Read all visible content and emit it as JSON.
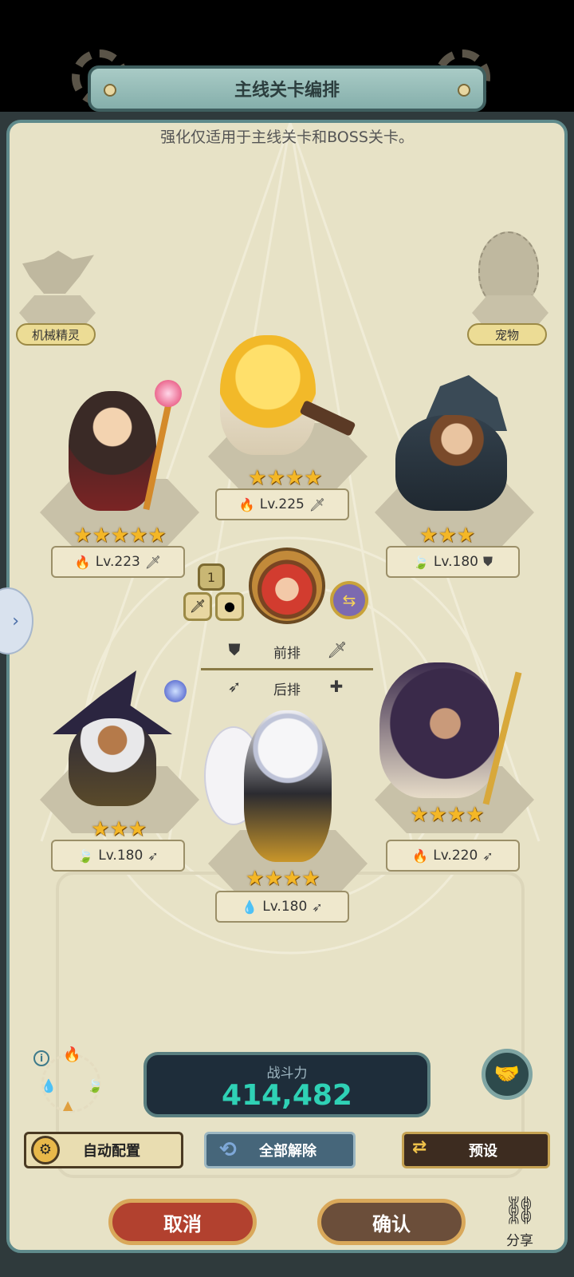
{
  "title": "主线关卡编排",
  "subtitle": "强化仅适用于主线关卡和BOSS关卡。",
  "left_slot": {
    "label": "机械精灵"
  },
  "right_slot": {
    "label": "宠物"
  },
  "heroes": {
    "top_center": {
      "stars": 4,
      "level": "Lv.225",
      "element": "fire",
      "role": "sword"
    },
    "front_left": {
      "stars": 5,
      "level": "Lv.223",
      "element": "fire",
      "role": "sword"
    },
    "front_right": {
      "stars": 3,
      "level": "Lv.180",
      "element": "wind",
      "role": "shield"
    },
    "back_left": {
      "stars": 3,
      "level": "Lv.180",
      "element": "wind",
      "role": "bow"
    },
    "back_center": {
      "stars": 4,
      "level": "Lv.180",
      "element": "water",
      "role": "bow"
    },
    "back_right": {
      "stars": 4,
      "level": "Lv.220",
      "element": "fire",
      "role": "bow"
    }
  },
  "leader": {
    "badge": "1"
  },
  "rows": {
    "front": "前排",
    "back": "后排"
  },
  "power": {
    "label": "战斗力",
    "value": "414,482"
  },
  "buttons": {
    "auto": "自动配置",
    "unequip_all": "全部解除",
    "preset": "预设",
    "cancel": "取消",
    "confirm": "确认",
    "share": "分享"
  },
  "colors": {
    "accent_teal": "#2fd1b5",
    "cancel_red": "#b2412f",
    "confirm_brown": "#6b4e3a",
    "star_gold": "#f4b726"
  }
}
